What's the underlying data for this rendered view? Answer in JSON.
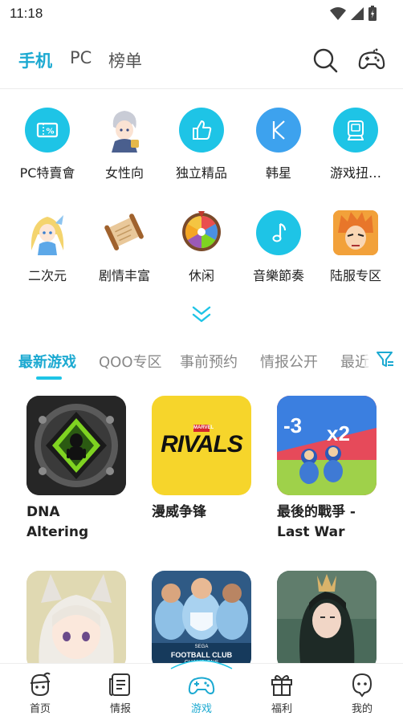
{
  "status_bar": {
    "time": "11:18"
  },
  "top_tabs": [
    {
      "label": "手机",
      "active": true
    },
    {
      "label": "PC",
      "active": false
    },
    {
      "label": "榜单",
      "active": false
    }
  ],
  "categories": [
    {
      "label": "PC特賣會",
      "icon": "ticket-percent-icon"
    },
    {
      "label": "女性向",
      "icon": "anime-boy-avatar"
    },
    {
      "label": "独立精品",
      "icon": "thumbs-up-icon"
    },
    {
      "label": "韩星",
      "icon": "letter-k-icon"
    },
    {
      "label": "游戏扭…",
      "icon": "gacha-machine-icon"
    },
    {
      "label": "二次元",
      "icon": "anime-girl-avatar"
    },
    {
      "label": "剧情丰富",
      "icon": "scroll-icon"
    },
    {
      "label": "休闲",
      "icon": "prize-wheel-icon"
    },
    {
      "label": "音樂節奏",
      "icon": "music-note-icon"
    },
    {
      "label": "陆服专区",
      "icon": "anime-character-avatar"
    }
  ],
  "section_tabs": [
    {
      "label": "最新游戏",
      "active": true
    },
    {
      "label": "QOO专区",
      "active": false
    },
    {
      "label": "事前预约",
      "active": false
    },
    {
      "label": "情报公开",
      "active": false
    },
    {
      "label": "最近",
      "active": false
    }
  ],
  "games": [
    {
      "title": "DNA Altering",
      "thumb_bg": "#2b2b2b"
    },
    {
      "title": "漫威争锋",
      "thumb_bg": "#f6d52b",
      "logo_small": "MARVEL",
      "logo": "RIVALS"
    },
    {
      "title": "最後的戰爭 - Last War",
      "thumb_bg": "#e64a5a",
      "badge_left": "-3",
      "badge_right": "x2"
    },
    {
      "title": "",
      "thumb_bg": "#d9d2c4"
    },
    {
      "title": "",
      "thumb_bg": "#9ac3e3",
      "banner_small": "SEGA",
      "banner": "FOOTBALL CLUB",
      "banner_sub": "CHAMPIONS"
    },
    {
      "title": "",
      "thumb_bg": "#3f5b4e"
    }
  ],
  "bottom_nav": [
    {
      "label": "首页",
      "icon": "home-mascot-icon",
      "active": false
    },
    {
      "label": "情报",
      "icon": "news-icon",
      "active": false
    },
    {
      "label": "游戏",
      "icon": "gamepad-icon",
      "active": true
    },
    {
      "label": "福利",
      "icon": "gift-icon",
      "active": false
    },
    {
      "label": "我的",
      "icon": "profile-icon",
      "active": false
    }
  ],
  "colors": {
    "accent": "#1ba9d1",
    "accent_light": "#1ec4e6",
    "text": "#222222",
    "muted": "#888888"
  }
}
